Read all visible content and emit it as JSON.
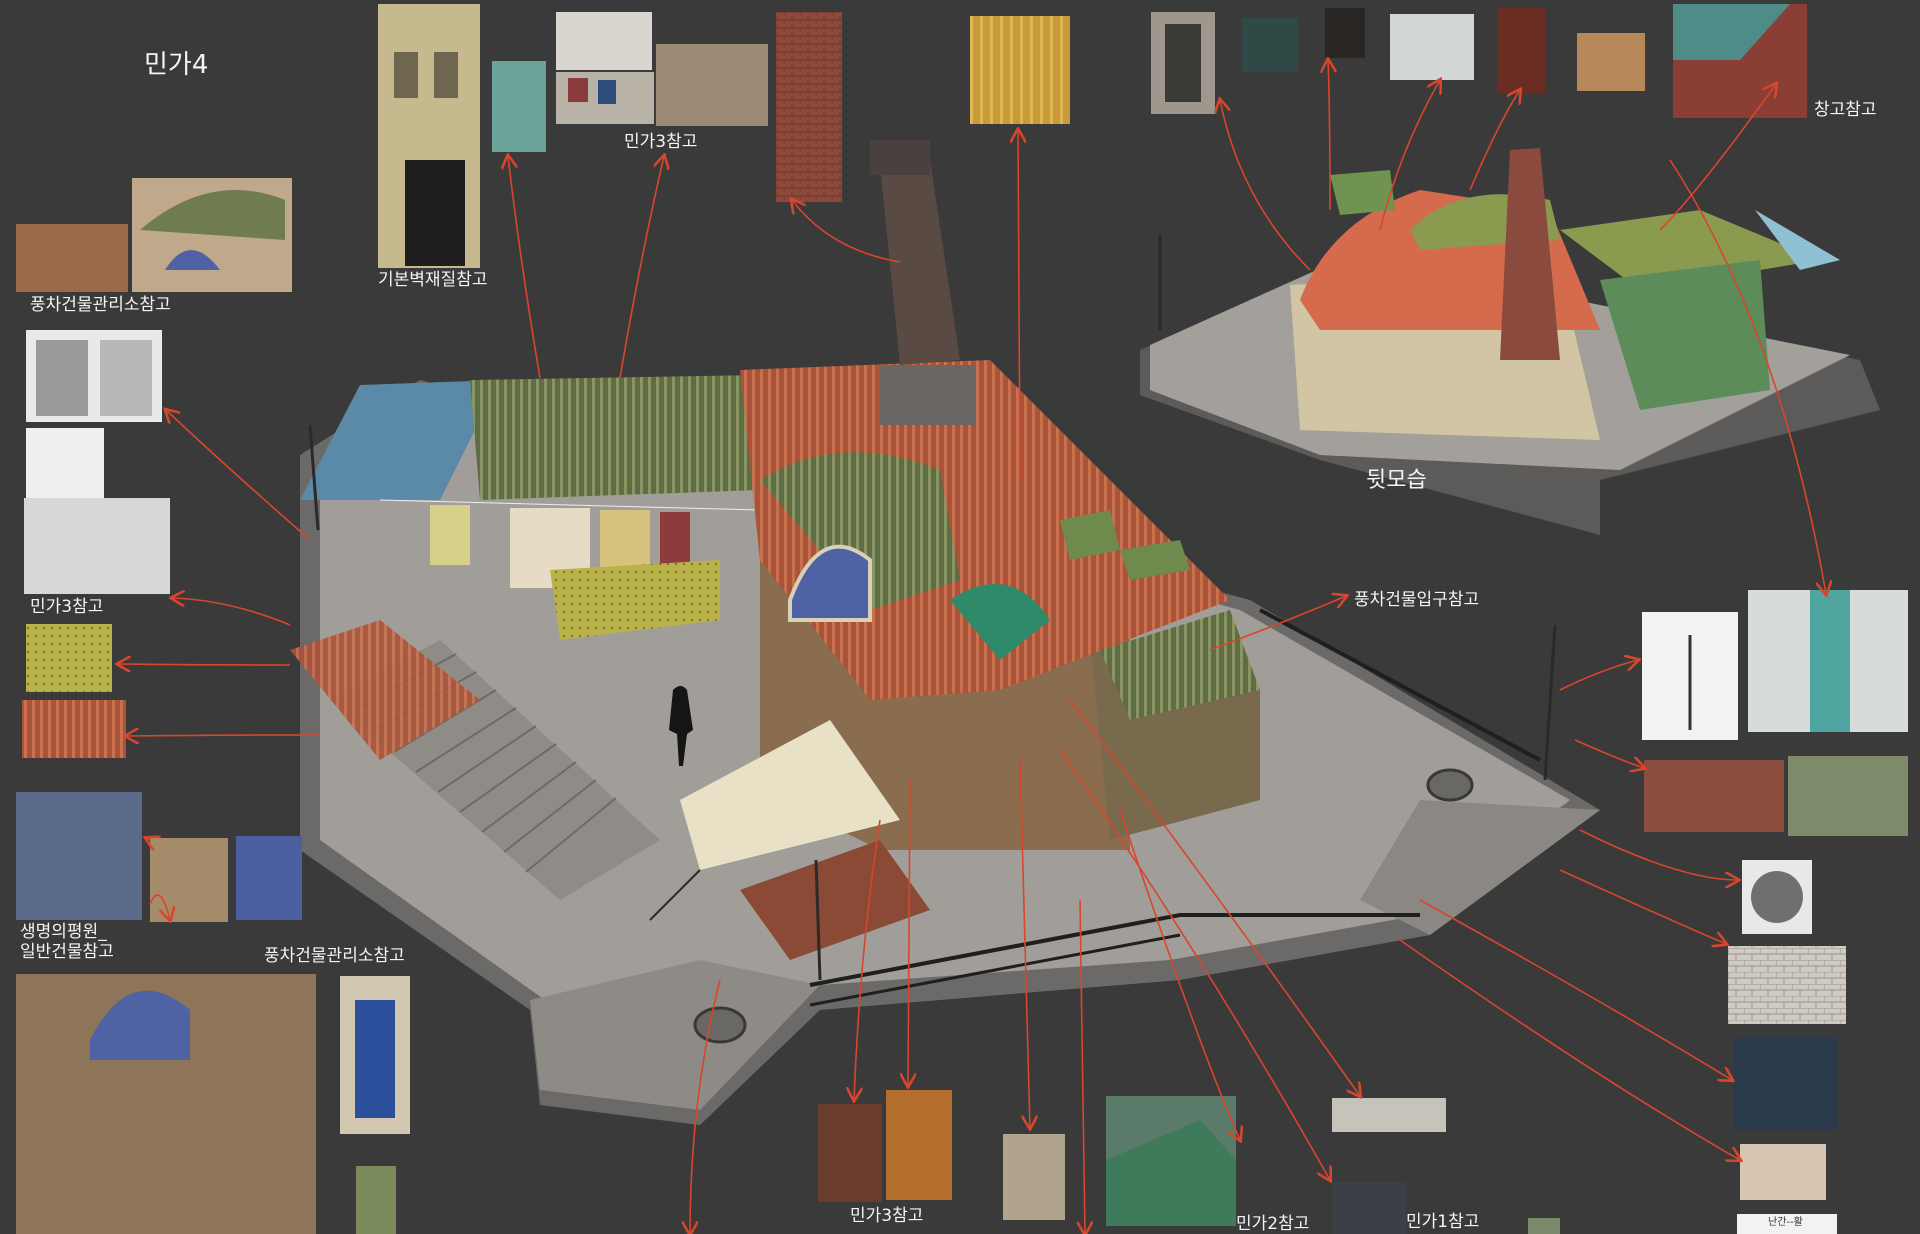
{
  "sheet": {
    "title": "민가4",
    "back_view_label": "뒷모습",
    "labels": {
      "windmill_office_top": "풍차건물관리소참고",
      "wall_material": "기본벽재질참고",
      "house3_top": "민가3참고",
      "warehouse": "창고참고",
      "house3_left": "민가3참고",
      "windmill_entrance": "풍차건물입구참고",
      "life_tree_line1": "생명의평원_",
      "life_tree_line2": "일반건물참고",
      "windmill_office_bottom": "풍차건물관리소참고",
      "house3_bottom": "민가3참고",
      "house2": "민가2참고",
      "house1": "민가1참고",
      "corner_small": "난간--활"
    }
  },
  "colors": {
    "background": "#3a3a3b",
    "arrow": "#d8462b",
    "roof_rust": "#b9583f",
    "roof_green": "#6f7c4f",
    "ground": "#9c9a97"
  }
}
